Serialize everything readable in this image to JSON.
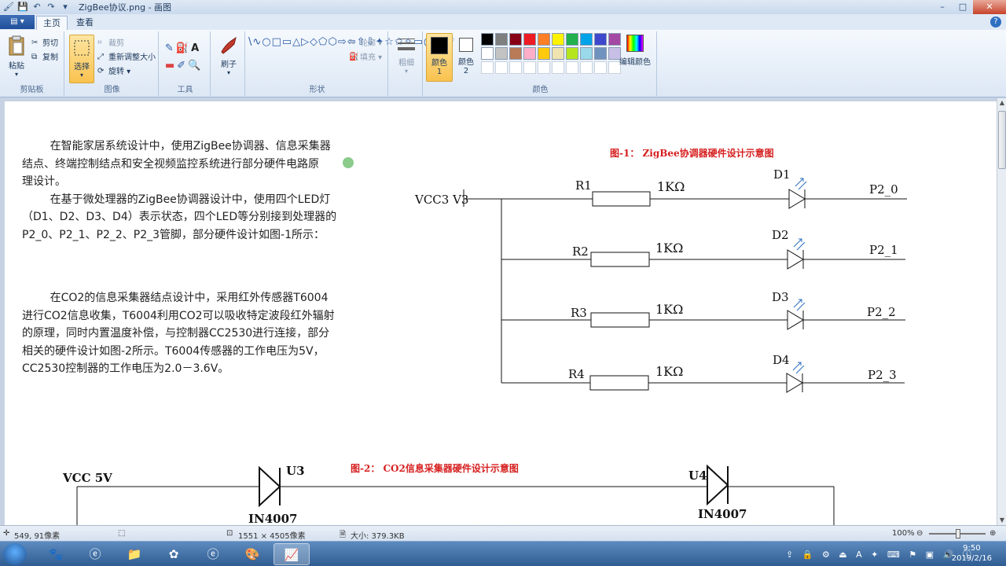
{
  "window": {
    "title": "ZigBee协议.png - 画图",
    "controls": [
      "–",
      "□",
      "✕"
    ]
  },
  "quick_access": [
    "save-icon",
    "undo-icon",
    "redo-icon",
    "dropdown-icon"
  ],
  "tabs": {
    "app_menu": "▤ ▾",
    "home": "主页",
    "view": "查看"
  },
  "ribbon": {
    "clipboard": {
      "paste": "粘贴",
      "cut": "剪切",
      "copy": "复制",
      "label": "剪贴板"
    },
    "image": {
      "select": "选择",
      "crop": "裁剪",
      "resize": "重新调整大小",
      "rotate": "旋转",
      "label": "图像"
    },
    "tools": {
      "label": "工具"
    },
    "brushes": {
      "label": "刷子"
    },
    "shapes": {
      "outline": "轮廓",
      "fill": "填充",
      "label": "形状",
      "glyphs": "\\∿○□▭△▷◇⬠⬡⇨⇦⇧⇩✦☆✩✧▭◯◌♡"
    },
    "size": {
      "label": "粗细"
    },
    "color1": {
      "label": "颜色 1"
    },
    "color2": {
      "label": "颜色 2"
    },
    "colors": {
      "label": "颜色",
      "edit": "编辑颜色",
      "palette": [
        "#000000",
        "#7f7f7f",
        "#880015",
        "#ed1c24",
        "#ff7f27",
        "#fff200",
        "#22b14c",
        "#00a2e8",
        "#3f48cc",
        "#a349a4",
        "#ffffff",
        "#c3c3c3",
        "#b97a57",
        "#ffaec9",
        "#ffc90e",
        "#efe4b0",
        "#b5e61d",
        "#99d9ea",
        "#7092be",
        "#c8bfe7"
      ]
    }
  },
  "document": {
    "para1": "        在智能家居系统设计中，使用ZigBee协调器、信息采集器\n结点、终端控制结点和安全视频监控系统进行部分硬件电路原\n理设计。\n        在基于微处理器的ZigBee协调器设计中，使用四个LED灯\n（D1、D2、D3、D4）表示状态，四个LED等分别接到处理器的\nP2_0、P2_1、P2_2、P2_3管脚，部分硬件设计如图-1所示：",
    "para2": "        在CO2的信息采集器结点设计中，采用红外传感器T6004\n进行CO2信息收集，T6004利用CO2可以吸收特定波段红外辐射\n的原理，同时内置温度补偿，与控制器CC2530进行连接，部分\n相关的硬件设计如图-2所示。T6004传感器的工作电压为5V，\nCC2530控制器的工作电压为2.0－3.6V。",
    "fig1_caption": "图-1：  ZigBee协调器硬件设计示意图",
    "fig2_caption": "图-2：  CO2信息采集器硬件设计示意图",
    "circuit1": {
      "vcc": "VCC3 V3",
      "rows": [
        {
          "r": "R1",
          "val": "1KΩ",
          "d": "D1",
          "pin": "P2_0"
        },
        {
          "r": "R2",
          "val": "1KΩ",
          "d": "D2",
          "pin": "P2_1"
        },
        {
          "r": "R3",
          "val": "1KΩ",
          "d": "D3",
          "pin": "P2_2"
        },
        {
          "r": "R4",
          "val": "1KΩ",
          "d": "D4",
          "pin": "P2_3"
        }
      ]
    },
    "circuit2": {
      "vcc": "VCC  5V",
      "u3": "U3",
      "u4": "U4",
      "diode1": "IN4007",
      "diode2": "IN4007"
    }
  },
  "status": {
    "cursor": "549, 91像素",
    "dimensions": "1551 × 4505像素",
    "size": "大小: 379.3KB",
    "zoom": "100%"
  },
  "taskbar": {
    "clock_time": "9:50",
    "clock_date": "2019/2/16"
  }
}
